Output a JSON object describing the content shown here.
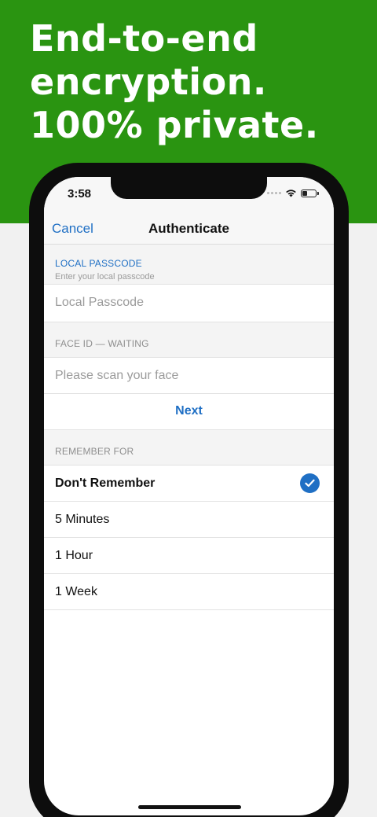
{
  "promo": {
    "headline_line1": "End-to-end",
    "headline_line2": "encryption.",
    "headline_line3": "100% private.",
    "background_color": "#2a9411"
  },
  "status_bar": {
    "time": "3:58",
    "icons": [
      "cellular-signal-icon",
      "wifi-icon",
      "battery-icon"
    ]
  },
  "navbar": {
    "cancel_label": "Cancel",
    "title": "Authenticate"
  },
  "local_passcode": {
    "header": "LOCAL PASSCODE",
    "subheader": "Enter your local passcode",
    "placeholder": "Local Passcode"
  },
  "face_id": {
    "header": "FACE ID — WAITING",
    "prompt": "Please scan your face"
  },
  "next_label": "Next",
  "remember": {
    "header": "REMEMBER FOR",
    "options": [
      {
        "label": "Don't Remember",
        "selected": true
      },
      {
        "label": "5 Minutes",
        "selected": false
      },
      {
        "label": "1 Hour",
        "selected": false
      },
      {
        "label": "1 Week",
        "selected": false
      }
    ]
  },
  "colors": {
    "accent": "#1f6fc4",
    "phone_frame": "#0d0d0d"
  }
}
